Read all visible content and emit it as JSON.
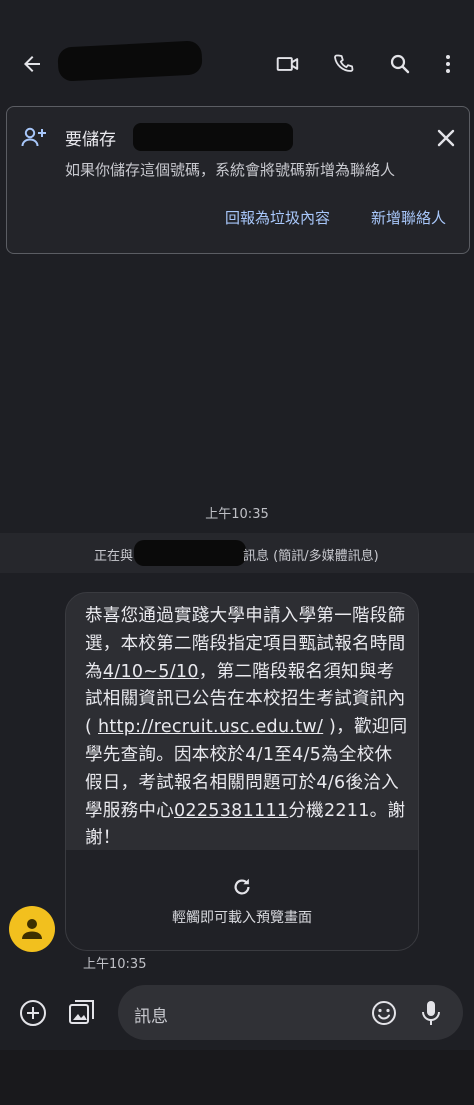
{
  "topbar": {
    "back_icon": "arrow-back-icon",
    "icons": [
      "video-call-icon",
      "phone-icon",
      "search-icon",
      "more-vert-icon"
    ]
  },
  "save_card": {
    "title_prefix": "要儲存",
    "description": "如果你儲存這個號碼，系統會將號碼新增為聯絡人",
    "report_label": "回報為垃圾內容",
    "add_contact_label": "新增聯絡人",
    "add_icon": "person-add-icon",
    "close_icon": "close-icon"
  },
  "conversation": {
    "date_time": "上午10:35",
    "system_prefix": "正在與",
    "system_suffix": "訊息 (簡訊/多媒體訊息)"
  },
  "message": {
    "text_parts": [
      "恭喜您通過實踐大學申請入學第一階段篩選，本校第二階段指定項目甄試報名時間為",
      "4/10~5/10",
      "，第二階段報名須知與考試相關資訊已公告在本校招生考試資訊內( ",
      "http://recruit.usc.edu.tw/",
      " )，歡迎同學先查詢。因本校於4/1至4/5為全校休假日，考試報名相關問題可於4/6後洽入學服務中心",
      "0225381111",
      "分機2211。謝謝！"
    ],
    "preview_label": "輕觸即可載入預覽畫面",
    "preview_icon": "refresh-icon",
    "timestamp": "上午10:35",
    "avatar_icon": "avatar-person-icon"
  },
  "composer": {
    "placeholder": "訊息",
    "add_icon": "add-circle-icon",
    "gallery_icon": "gallery-icon",
    "emoji_icon": "emoji-icon",
    "mic_icon": "mic-icon"
  }
}
